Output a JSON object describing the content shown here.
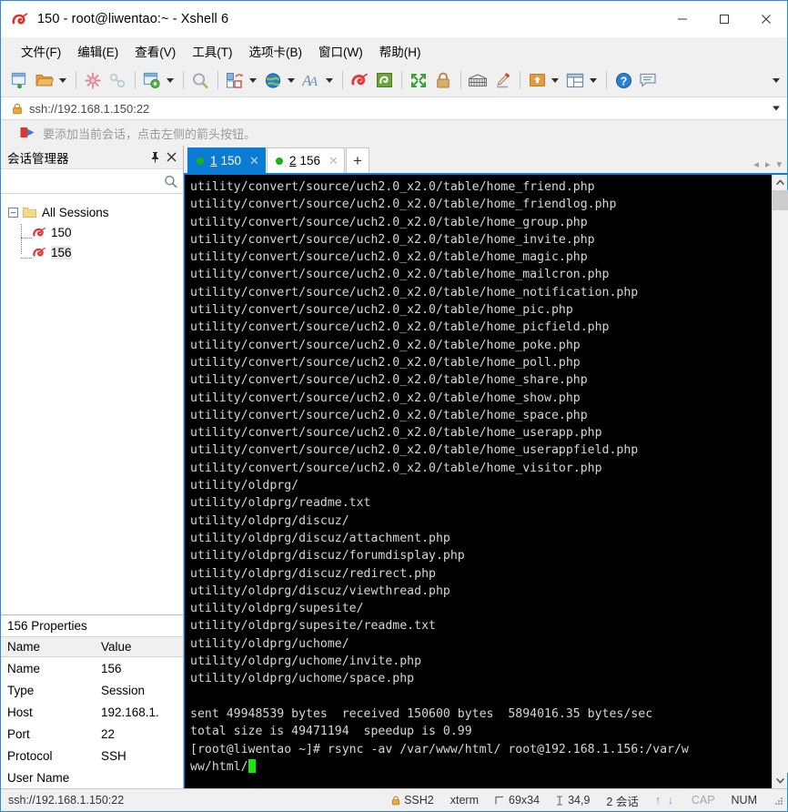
{
  "window": {
    "title": "150 - root@liwentao:~ - Xshell 6",
    "app_icon": "xshell-snail-icon",
    "minimize": "–",
    "maximize": "☐",
    "close": "✕"
  },
  "menubar": {
    "items": [
      {
        "label": "文件(F)",
        "name": "menu-file"
      },
      {
        "label": "编辑(E)",
        "name": "menu-edit"
      },
      {
        "label": "查看(V)",
        "name": "menu-view"
      },
      {
        "label": "工具(T)",
        "name": "menu-tools"
      },
      {
        "label": "选项卡(B)",
        "name": "menu-tabs"
      },
      {
        "label": "窗口(W)",
        "name": "menu-window"
      },
      {
        "label": "帮助(H)",
        "name": "menu-help"
      }
    ]
  },
  "toolbar": {
    "overflow_label": "▾",
    "buttons": [
      "new-session-icon",
      "open-folder-icon",
      "folder-dropdown-arrow",
      "separator",
      "disconnect-icon",
      "reconnect-icon",
      "separator",
      "session-properties-icon",
      "properties-dropdown-arrow",
      "separator",
      "find-icon",
      "separator",
      "layout-icon",
      "layout-dropdown-arrow",
      "globe-icon",
      "globe-dropdown-arrow",
      "font-icon",
      "font-dropdown-arrow",
      "separator",
      "xshell-icon",
      "xftp-icon",
      "separator",
      "fullscreen-icon",
      "lock-icon",
      "separator",
      "keyboard-icon",
      "highlight-pen-icon",
      "separator",
      "transfer-icon",
      "transfer-dropdown-arrow",
      "split-view-icon",
      "split-dropdown-arrow",
      "separator",
      "help-icon",
      "feedback-icon"
    ]
  },
  "addressbar": {
    "lock_icon": "lock-icon",
    "url": "ssh://192.168.1.150:22",
    "dropdown": "▾"
  },
  "notice": {
    "icon": "add-bookmark-icon",
    "text": "要添加当前会话，点击左侧的箭头按钮。"
  },
  "sidebar": {
    "title": "会话管理器",
    "pin_label": "⚐",
    "close_label": "✕",
    "search_icon": "search-icon",
    "tree": {
      "root": {
        "label": "All Sessions",
        "expander": "–",
        "icon": "folder-icon"
      },
      "children": [
        {
          "label": "150",
          "icon": "session-icon",
          "selected": false
        },
        {
          "label": "156",
          "icon": "session-icon",
          "selected": true
        }
      ]
    },
    "properties": {
      "title": "156 Properties",
      "columns": [
        "Name",
        "Value"
      ],
      "rows": [
        {
          "name": "Name",
          "value": "156"
        },
        {
          "name": "Type",
          "value": "Session"
        },
        {
          "name": "Host",
          "value": "192.168.1."
        },
        {
          "name": "Port",
          "value": "22"
        },
        {
          "name": "Protocol",
          "value": "SSH"
        },
        {
          "name": "User Name",
          "value": ""
        }
      ]
    }
  },
  "tabs": {
    "items": [
      {
        "number": "1",
        "label": "150",
        "active": true,
        "status": "connected",
        "close": "✕"
      },
      {
        "number": "2",
        "label": "156",
        "active": false,
        "status": "connected",
        "close": "✕"
      }
    ],
    "add_label": "+",
    "nav_prev": "◂",
    "nav_next": "▸",
    "nav_menu": "▾"
  },
  "terminal": {
    "lines": [
      "utility/convert/source/uch2.0_x2.0/table/home_friend.php",
      "utility/convert/source/uch2.0_x2.0/table/home_friendlog.php",
      "utility/convert/source/uch2.0_x2.0/table/home_group.php",
      "utility/convert/source/uch2.0_x2.0/table/home_invite.php",
      "utility/convert/source/uch2.0_x2.0/table/home_magic.php",
      "utility/convert/source/uch2.0_x2.0/table/home_mailcron.php",
      "utility/convert/source/uch2.0_x2.0/table/home_notification.php",
      "utility/convert/source/uch2.0_x2.0/table/home_pic.php",
      "utility/convert/source/uch2.0_x2.0/table/home_picfield.php",
      "utility/convert/source/uch2.0_x2.0/table/home_poke.php",
      "utility/convert/source/uch2.0_x2.0/table/home_poll.php",
      "utility/convert/source/uch2.0_x2.0/table/home_share.php",
      "utility/convert/source/uch2.0_x2.0/table/home_show.php",
      "utility/convert/source/uch2.0_x2.0/table/home_space.php",
      "utility/convert/source/uch2.0_x2.0/table/home_userapp.php",
      "utility/convert/source/uch2.0_x2.0/table/home_userappfield.php",
      "utility/convert/source/uch2.0_x2.0/table/home_visitor.php",
      "utility/oldprg/",
      "utility/oldprg/readme.txt",
      "utility/oldprg/discuz/",
      "utility/oldprg/discuz/attachment.php",
      "utility/oldprg/discuz/forumdisplay.php",
      "utility/oldprg/discuz/redirect.php",
      "utility/oldprg/discuz/viewthread.php",
      "utility/oldprg/supesite/",
      "utility/oldprg/supesite/readme.txt",
      "utility/oldprg/uchome/",
      "utility/oldprg/uchome/invite.php",
      "utility/oldprg/uchome/space.php",
      "",
      "sent 49948539 bytes  received 150600 bytes  5894016.35 bytes/sec",
      "total size is 49471194  speedup is 0.99"
    ],
    "prompt_line": "[root@liwentao ~]# rsync -av /var/www/html/ root@192.168.1.156:/var/w",
    "prompt_wrap": "ww/html/",
    "cursor_color": "#19e619",
    "bg_color": "#000000",
    "fg_color": "#d6d6d6"
  },
  "scrollbar": {
    "up_arrow": "ⱏ",
    "down_arrow": "ⱟ"
  },
  "statusbar": {
    "url": "ssh://192.168.1.150:22",
    "protocol": "SSH2",
    "term_type": "xterm",
    "size": "69x34",
    "cursor_pos": "34,9",
    "sessions": "2 会话",
    "arrows": "↑ ↓",
    "cap": "CAP",
    "num": "NUM"
  },
  "colors": {
    "accent": "#0a7cd4",
    "window_border": "#2e8bd0",
    "chrome": "#f0f0f0",
    "terminal_bg": "#000000",
    "green_dot": "#19b319"
  }
}
